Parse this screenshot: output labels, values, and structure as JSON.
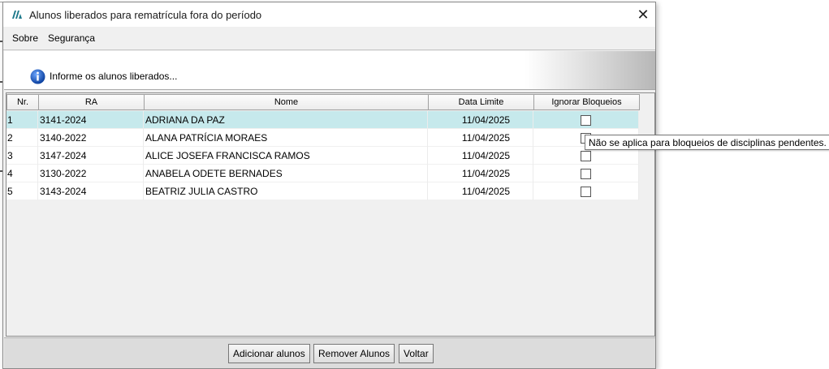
{
  "window": {
    "title": "Alunos liberados para rematrícula fora do período",
    "close_symbol": "✕"
  },
  "menu": {
    "items": [
      {
        "label": "Sobre"
      },
      {
        "label": "Segurança"
      }
    ]
  },
  "info": {
    "icon": "info-icon",
    "text": "Informe os alunos liberados..."
  },
  "grid": {
    "columns": [
      "Nr.",
      "RA",
      "Nome",
      "Data Limite",
      "Ignorar Bloqueios"
    ],
    "rows": [
      {
        "nr": "1",
        "ra": "3141-2024",
        "nome": "ADRIANA DA PAZ",
        "data": "11/04/2025",
        "ignorar": false,
        "selected": true
      },
      {
        "nr": "2",
        "ra": "3140-2022",
        "nome": "ALANA PATRÍCIA MORAES",
        "data": "11/04/2025",
        "ignorar": false,
        "selected": false
      },
      {
        "nr": "3",
        "ra": "3147-2024",
        "nome": "ALICE JOSEFA FRANCISCA RAMOS",
        "data": "11/04/2025",
        "ignorar": false,
        "selected": false
      },
      {
        "nr": "4",
        "ra": "3130-2022",
        "nome": "ANABELA ODETE BERNADES",
        "data": "11/04/2025",
        "ignorar": false,
        "selected": false
      },
      {
        "nr": "5",
        "ra": "3143-2024",
        "nome": "BEATRIZ JULIA CASTRO",
        "data": "11/04/2025",
        "ignorar": false,
        "selected": false
      }
    ]
  },
  "tooltip": {
    "text": "Não se aplica para bloqueios de disciplinas pendentes."
  },
  "footer": {
    "add_label": "Adicionar alunos",
    "remove_label": "Remover Alunos",
    "back_label": "Voltar"
  },
  "colors": {
    "selected_row": "#c6e9ec",
    "app_logo": "#1f7a8c"
  }
}
